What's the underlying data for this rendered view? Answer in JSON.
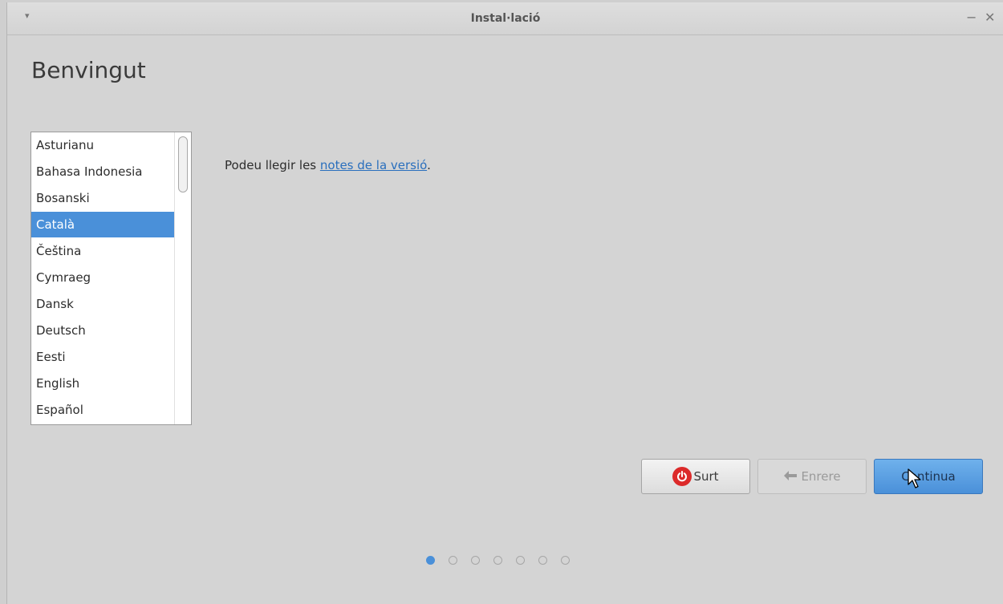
{
  "window": {
    "title": "Instal·lació",
    "menu_glyph": "▾",
    "minimize_glyph": "−",
    "close_glyph": "✕"
  },
  "page": {
    "title": "Benvingut"
  },
  "languages": {
    "items": [
      "Asturianu",
      "Bahasa Indonesia",
      "Bosanski",
      "Català",
      "Čeština",
      "Cymraeg",
      "Dansk",
      "Deutsch",
      "Eesti",
      "English",
      "Español"
    ],
    "selected": "Català"
  },
  "release": {
    "prefix": "Podeu llegir les ",
    "link": "notes de la versió",
    "suffix": "."
  },
  "buttons": {
    "quit": "Surt",
    "back": "Enrere",
    "continue": "Continua"
  },
  "progress": {
    "total_steps": 7,
    "current_step": 1
  },
  "colors": {
    "accent": "#4a90d9",
    "link": "#2a6fbd",
    "quit_icon": "#dc2a2a"
  },
  "icons": {
    "quit": "power-icon",
    "back": "arrow-left-icon",
    "menu": "chevron-down-icon",
    "minimize": "minimize-icon",
    "close": "close-icon"
  }
}
